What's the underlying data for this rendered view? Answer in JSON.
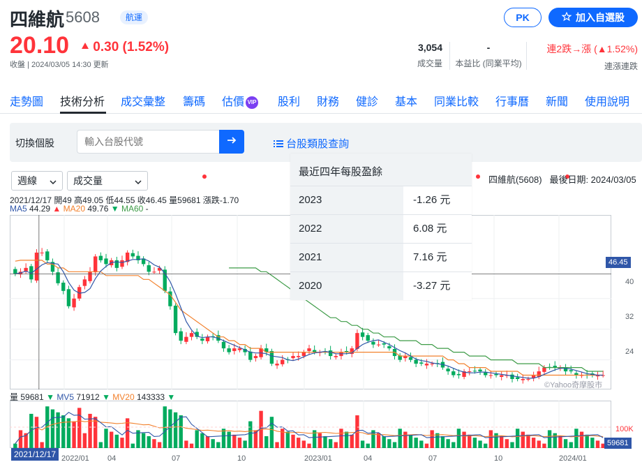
{
  "header": {
    "name": "四維航",
    "code": "5608",
    "category": "航運",
    "pk_label": "PK",
    "add_watch_label": "加入自選股"
  },
  "quote": {
    "price": "20.10",
    "change": "0.30 (1.52%)",
    "close_status": "收盤 | 2024/03/05 14:30 更新",
    "volume_value": "3,054",
    "volume_label": "成交量",
    "pe_value": "-",
    "pe_label": "本益比 (同業平均)",
    "streak_value": "連2跌→漲 (▲1.52%)",
    "streak_label": "連漲連跌"
  },
  "colors": {
    "up": "#ff333a",
    "down": "#00ab5e",
    "accent": "#0f69ff",
    "ma5": "#2f56a8",
    "ma20": "#f2812d",
    "ma60": "#3d9b47"
  },
  "nav": {
    "items": [
      "走勢圖",
      "技術分析",
      "成交彙整",
      "籌碼",
      "估價",
      "股利",
      "財務",
      "健診",
      "基本",
      "同業比較",
      "行事曆",
      "新聞",
      "使用說明"
    ],
    "active": "技術分析",
    "vip_badge": "VIP"
  },
  "search": {
    "label": "切換個股",
    "placeholder": "輸入台股代號",
    "category_link": "台股類股查詢"
  },
  "chart_controls": {
    "period": "週線",
    "indicator": "成交量",
    "stock_label": "四維航(5608)",
    "last_date": "最後日期: 2024/03/05"
  },
  "candle_info": {
    "text": "2021/12/17 開49 高49.05 低44.55 收46.45 量59681 漲跌-1.70",
    "ma5_label": "MA5",
    "ma5_value": "44.29",
    "ma20_label": "MA20",
    "ma20_value": "49.76",
    "ma60_label": "MA60",
    "ma60_value": "-"
  },
  "volume_info": {
    "vol_label": "量",
    "vol_value": "59681",
    "mv5_label": "MV5",
    "mv5_value": "71912",
    "mv20_label": "MV20",
    "mv20_value": "143333"
  },
  "eps_table": {
    "title": "最近四年每股盈餘",
    "rows": [
      {
        "year": "2023",
        "value": "-1.26 元"
      },
      {
        "year": "2022",
        "value": "6.08 元"
      },
      {
        "year": "2021",
        "value": "7.16 元"
      },
      {
        "year": "2020",
        "value": "-3.27 元"
      }
    ]
  },
  "watermark": "©Yahoo奇摩股市",
  "chart_data": {
    "type": "candlestick",
    "price_axis": {
      "ticks": [
        24,
        32,
        40
      ],
      "range": [
        17,
        60
      ]
    },
    "volume_axis": {
      "ticks": [
        "100K"
      ]
    },
    "crosshair_price": "46.45",
    "crosshair_date": "2021/12/17",
    "last_volume_tag": "59681",
    "x_labels": [
      "2022/01",
      "04",
      "07",
      "10",
      "2023/01",
      "04",
      "07",
      "10",
      "2024/01"
    ],
    "weekly_close": [
      46.45,
      47,
      48,
      45,
      52,
      52,
      50,
      47,
      44,
      42,
      38,
      40,
      43,
      45,
      47,
      51,
      50,
      49,
      50,
      48,
      50,
      52,
      51,
      50,
      49,
      47,
      47,
      48,
      42,
      38,
      31,
      29,
      30,
      31,
      30,
      29,
      30,
      30,
      29,
      27,
      26,
      27,
      27,
      26,
      24,
      25,
      27,
      26,
      23,
      23,
      24,
      24,
      25,
      25,
      26,
      27,
      26,
      26,
      26,
      25,
      25,
      26,
      26,
      27,
      31,
      30,
      29,
      28,
      28,
      28,
      27,
      25,
      24,
      25,
      24,
      23,
      23,
      23,
      23,
      23,
      22,
      21,
      20,
      20,
      21,
      21,
      21,
      21,
      20,
      20,
      20,
      20,
      20,
      19,
      19,
      19,
      19,
      20,
      21,
      22,
      22,
      22,
      22,
      21,
      21,
      20,
      20,
      20,
      20,
      20,
      20
    ],
    "ma20": [
      49.76,
      50,
      50,
      50,
      50,
      50,
      49,
      49,
      48,
      48,
      47,
      47,
      47,
      47,
      47,
      47,
      47,
      46,
      46,
      46,
      46,
      46,
      46,
      46,
      45,
      45,
      44,
      43,
      42,
      41,
      39,
      37,
      36,
      35,
      34,
      33,
      32,
      31,
      30,
      30,
      29,
      29,
      28,
      28,
      27,
      27,
      27,
      26,
      26,
      26,
      26,
      26,
      26,
      26,
      26,
      26,
      26,
      26,
      26,
      26,
      26,
      26,
      26,
      26,
      26,
      26,
      26,
      26,
      26,
      26,
      26,
      26,
      25,
      25,
      25,
      25,
      25,
      25,
      25,
      25,
      25,
      24,
      24,
      23,
      23,
      22,
      22,
      22,
      22,
      21,
      21,
      21,
      21,
      21,
      21,
      20,
      20,
      20,
      20,
      20,
      20,
      20,
      20,
      20,
      20,
      20,
      20,
      20,
      20,
      20,
      20
    ],
    "ma60": [
      null,
      null,
      null,
      null,
      null,
      null,
      null,
      null,
      null,
      null,
      null,
      null,
      null,
      null,
      null,
      null,
      null,
      null,
      null,
      null,
      null,
      null,
      null,
      null,
      null,
      null,
      null,
      null,
      null,
      null,
      null,
      null,
      null,
      null,
      null,
      null,
      null,
      null,
      null,
      null,
      48,
      48,
      48,
      48,
      48,
      48,
      47,
      47,
      46,
      45,
      44,
      43,
      42,
      41,
      40,
      39,
      38,
      37,
      36,
      35,
      35,
      34,
      34,
      33,
      33,
      32,
      32,
      31,
      31,
      30,
      30,
      30,
      29,
      29,
      29,
      29,
      28,
      28,
      28,
      27,
      27,
      27,
      26,
      26,
      26,
      25,
      25,
      25,
      25,
      24,
      24,
      24,
      24,
      24,
      23,
      23,
      23,
      23,
      23,
      22,
      22,
      22,
      22,
      22,
      22,
      22,
      22,
      21,
      21,
      21,
      21
    ]
  }
}
